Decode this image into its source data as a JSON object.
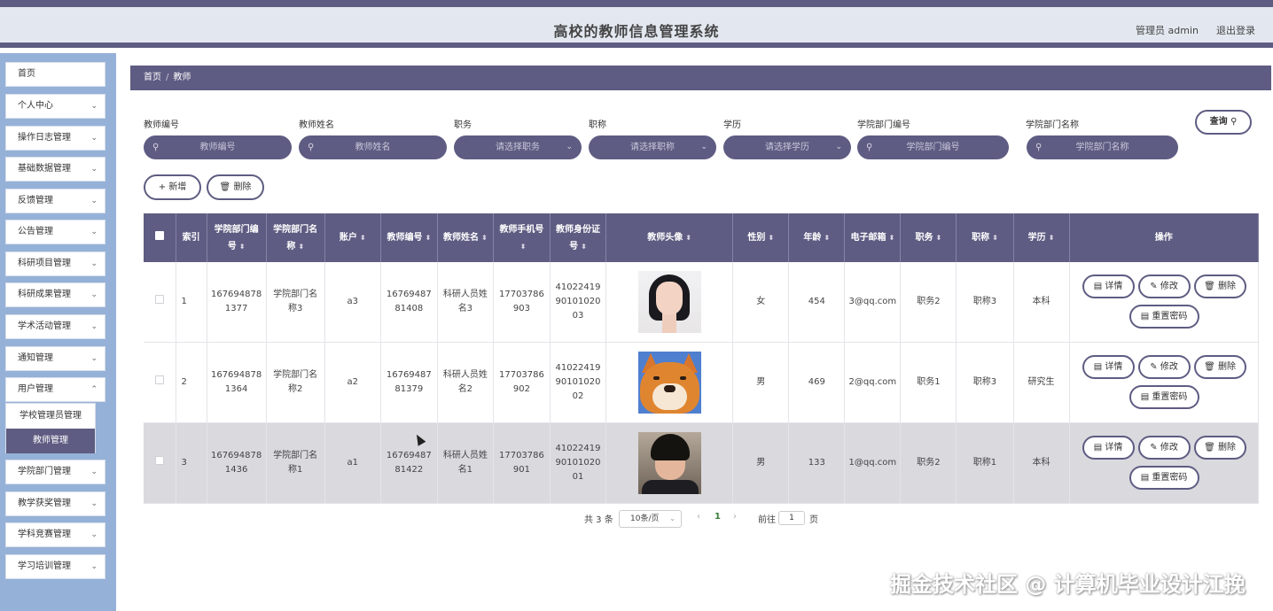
{
  "header": {
    "title": "高校的教师信息管理系统",
    "admin": "管理员 admin",
    "logout": "退出登录"
  },
  "sidebar": {
    "items": [
      {
        "label": "首页"
      },
      {
        "label": "个人中心"
      },
      {
        "label": "操作日志管理"
      },
      {
        "label": "基础数据管理"
      },
      {
        "label": "反馈管理"
      },
      {
        "label": "公告管理"
      },
      {
        "label": "科研项目管理"
      },
      {
        "label": "科研成果管理"
      },
      {
        "label": "学术活动管理"
      },
      {
        "label": "通知管理"
      },
      {
        "label": "用户管理"
      },
      {
        "label": "学院部门管理"
      },
      {
        "label": "教学获奖管理"
      },
      {
        "label": "学科竞赛管理"
      },
      {
        "label": "学习培训管理"
      }
    ],
    "submenu": [
      {
        "label": "学校管理员管理"
      },
      {
        "label": "教师管理"
      }
    ]
  },
  "breadcrumb": {
    "home": "首页",
    "sep": "/",
    "current": "教师"
  },
  "search": {
    "fields": [
      {
        "label": "教师编号",
        "placeholder": "教师编号"
      },
      {
        "label": "教师姓名",
        "placeholder": "教师姓名"
      },
      {
        "label": "职务",
        "placeholder": "请选择职务"
      },
      {
        "label": "职称",
        "placeholder": "请选择职称"
      },
      {
        "label": "学历",
        "placeholder": "请选择学历"
      },
      {
        "label": "学院部门编号",
        "placeholder": "学院部门编号"
      },
      {
        "label": "学院部门名称",
        "placeholder": "学院部门名称"
      }
    ],
    "query_label": "查询"
  },
  "actions": {
    "add_label": "+ 新增",
    "delete_label": "删除"
  },
  "table": {
    "headers": [
      "索引",
      "学院部门编号",
      "学院部门名称",
      "账户",
      "教师编号",
      "教师姓名",
      "教师手机号",
      "教师身份证号",
      "教师头像",
      "性别",
      "年龄",
      "电子邮箱",
      "职务",
      "职称",
      "学历",
      "操作"
    ],
    "rows": [
      {
        "index": "1",
        "dept_no": "1676948781377",
        "dept_name": "学院部门名称3",
        "account": "a3",
        "teacher_no": "1676948781408",
        "teacher_name": "科研人员姓名3",
        "phone": "17703786903",
        "id_card": "410224199010102003",
        "avatar": "woman-portrait",
        "gender": "女",
        "age": "454",
        "email": "3@qq.com",
        "post": "职务2",
        "title": "职称3",
        "education": "本科"
      },
      {
        "index": "2",
        "dept_no": "1676948781364",
        "dept_name": "学院部门名称2",
        "account": "a2",
        "teacher_no": "1676948781379",
        "teacher_name": "科研人员姓名2",
        "phone": "17703786902",
        "id_card": "410224199010102002",
        "avatar": "shiba-dog",
        "gender": "男",
        "age": "469",
        "email": "2@qq.com",
        "post": "职务1",
        "title": "职称3",
        "education": "研究生"
      },
      {
        "index": "3",
        "dept_no": "1676948781436",
        "dept_name": "学院部门名称1",
        "account": "a1",
        "teacher_no": "1676948781422",
        "teacher_name": "科研人员姓名1",
        "phone": "17703786901",
        "id_card": "410224199010102001",
        "avatar": "man-portrait",
        "gender": "男",
        "age": "133",
        "email": "1@qq.com",
        "post": "职务2",
        "title": "职称1",
        "education": "本科"
      }
    ],
    "op_labels": {
      "detail": "详情",
      "edit": "修改",
      "delete": "删除",
      "reset": "重置密码"
    }
  },
  "pager": {
    "total": "共 3 条",
    "page_size": "10条/页",
    "current_page": "1",
    "goto_label": "前往",
    "goto_value": "1",
    "page_suffix": "页"
  },
  "watermark": "掘金技术社区 @ 计算机毕业设计江挽"
}
